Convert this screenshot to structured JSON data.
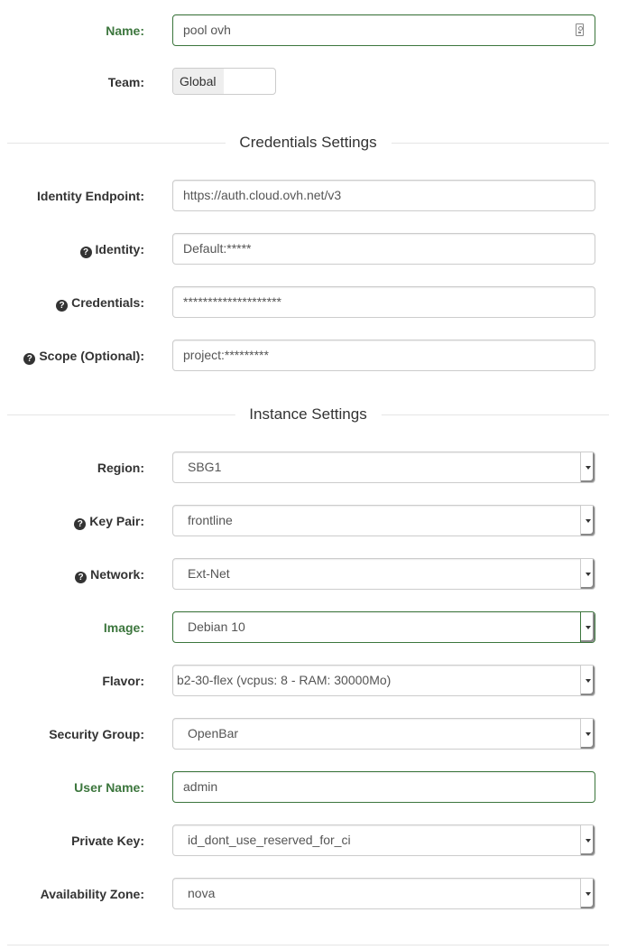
{
  "fields": {
    "name": {
      "label": "Name:",
      "value": "pool ovh"
    },
    "team": {
      "label": "Team:",
      "value": "Global"
    },
    "identity_endpoint": {
      "label": "Identity Endpoint:",
      "value": "https://auth.cloud.ovh.net/v3"
    },
    "identity": {
      "label": "Identity:",
      "value": "Default:*****"
    },
    "credentials": {
      "label": "Credentials:",
      "value": "********************"
    },
    "scope": {
      "label": "Scope (Optional):",
      "value": "project:*********"
    },
    "region": {
      "label": "Region:",
      "value": "SBG1"
    },
    "key_pair": {
      "label": "Key Pair:",
      "value": "frontline"
    },
    "network": {
      "label": "Network:",
      "value": "Ext-Net"
    },
    "image": {
      "label": "Image:",
      "value": "Debian 10"
    },
    "flavor": {
      "label": "Flavor:",
      "value": "b2-30-flex (vcpus: 8 - RAM: 30000Mo)"
    },
    "security_group": {
      "label": "Security Group:",
      "value": "OpenBar"
    },
    "user_name": {
      "label": "User Name:",
      "value": "admin"
    },
    "private_key": {
      "label": "Private Key:",
      "value": "id_dont_use_reserved_for_ci"
    },
    "availability_zone": {
      "label": "Availability Zone:",
      "value": "nova"
    }
  },
  "sections": {
    "credentials": "Credentials Settings",
    "instance": "Instance Settings"
  },
  "colors": {
    "success": "#3c763d",
    "label": "#333333",
    "input_text": "#555555",
    "border": "#cccccc"
  },
  "icons": {
    "help": "question-circle-icon",
    "field": "contact-card-icon",
    "select": "caret-down-icon"
  }
}
